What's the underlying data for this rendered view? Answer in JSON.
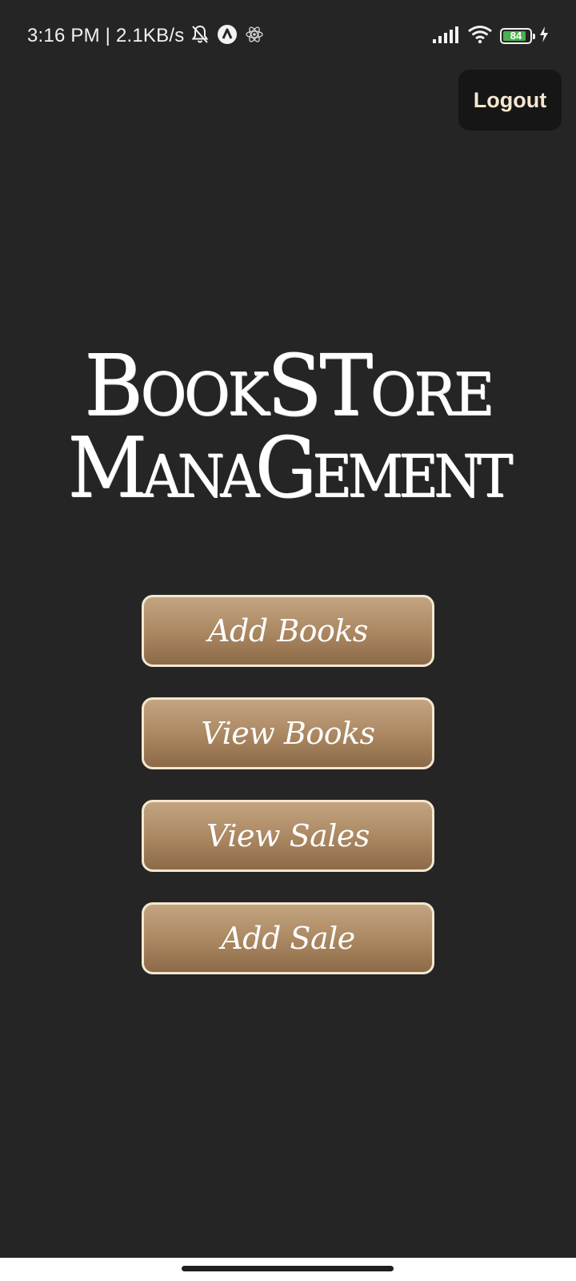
{
  "status_bar": {
    "time": "3:16 PM | 2.1KB/s",
    "battery_level": "84",
    "icons": [
      "bell-off-icon",
      "app-a-icon",
      "react-atom-icon",
      "signal-icon",
      "wifi-icon",
      "battery-icon",
      "charging-bolt-icon"
    ]
  },
  "header": {
    "logout_label": "Logout"
  },
  "title": {
    "line1": "BookSTore",
    "line2": "ManaGement"
  },
  "menu": {
    "items": [
      {
        "label": "Add Books"
      },
      {
        "label": "View Books"
      },
      {
        "label": "View Sales"
      },
      {
        "label": "Add Sale"
      }
    ]
  },
  "colors": {
    "background": "#252525",
    "button_gradient_top": "#c3a481",
    "button_gradient_bottom": "#8c6a48",
    "button_border": "#f4e7cf",
    "logout_text": "#f6e8cf",
    "battery_fill": "#4caf50"
  }
}
